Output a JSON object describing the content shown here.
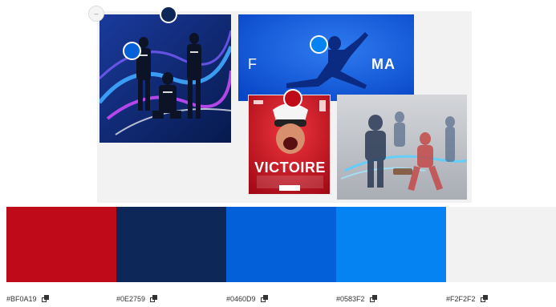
{
  "collage": {
    "collapse_icon": "minus-icon",
    "images": [
      {
        "name": "players-light-trails-image"
      },
      {
        "name": "fama-brand-image",
        "logo_left": "F",
        "logo_right": "MA"
      },
      {
        "name": "victoire-poster-image",
        "headline": "VICTOIRE"
      },
      {
        "name": "athletes-motion-image"
      }
    ],
    "pickers": [
      {
        "color": "#0E2759"
      },
      {
        "color": "#0460D9"
      },
      {
        "color": "#0583F2"
      },
      {
        "color": "#BF0A19"
      }
    ]
  },
  "palette": [
    {
      "hex": "#BF0A19",
      "label": "#BF0A19",
      "copy_icon": "copy-icon"
    },
    {
      "hex": "#0E2759",
      "label": "#0E2759",
      "copy_icon": "copy-icon"
    },
    {
      "hex": "#0460D9",
      "label": "#0460D9",
      "copy_icon": "copy-icon"
    },
    {
      "hex": "#0583F2",
      "label": "#0583F2",
      "copy_icon": "copy-icon"
    },
    {
      "hex": "#F2F2F2",
      "label": "#F2F2F2",
      "copy_icon": "copy-icon"
    }
  ]
}
